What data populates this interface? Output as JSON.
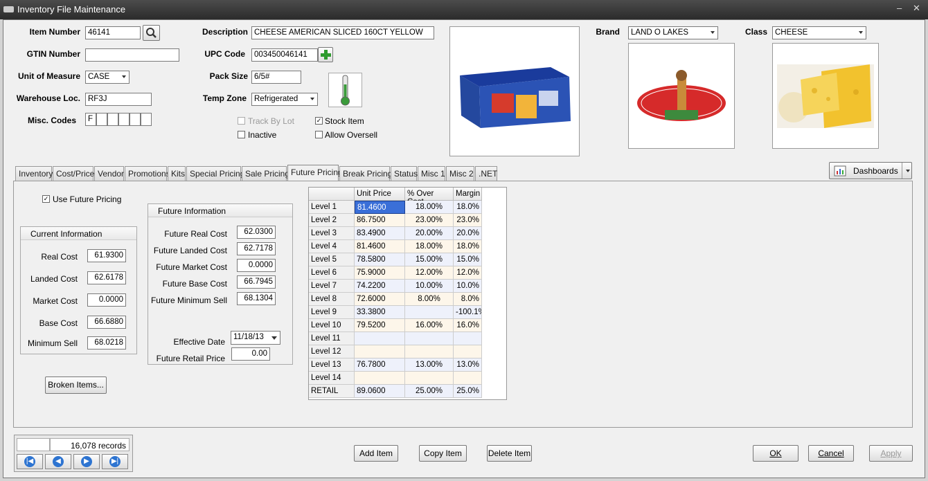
{
  "window": {
    "title": "Inventory File Maintenance",
    "minimize": "–",
    "close": "✕"
  },
  "header": {
    "item_number": {
      "label": "Item Number",
      "value": "46141"
    },
    "gtin": {
      "label": "GTIN Number",
      "value": ""
    },
    "uom": {
      "label": "Unit of Measure",
      "value": "CASE"
    },
    "warehouse": {
      "label": "Warehouse Loc.",
      "value": "RF3J"
    },
    "misc": {
      "label": "Misc. Codes",
      "values": [
        "F",
        "",
        "",
        "",
        "",
        ""
      ]
    },
    "description": {
      "label": "Description",
      "value": "CHEESE AMERICAN SLICED 160CT YELLOW"
    },
    "upc": {
      "label": "UPC Code",
      "value": "003450046141"
    },
    "pack": {
      "label": "Pack Size",
      "value": "6/5#"
    },
    "temp": {
      "label": "Temp Zone",
      "value": "Refrigerated"
    },
    "track_by_lot": {
      "label": "Track By Lot",
      "checked": false
    },
    "inactive": {
      "label": "Inactive",
      "checked": false
    },
    "stock_item": {
      "label": "Stock Item",
      "checked": true
    },
    "allow_oversell": {
      "label": "Allow Oversell",
      "checked": false
    },
    "brand": {
      "label": "Brand",
      "value": "LAND O LAKES"
    },
    "class": {
      "label": "Class",
      "value": "CHEESE"
    }
  },
  "tabs": [
    "Inventory",
    "Cost/Price",
    "Vendor",
    "Promotions",
    "Kits",
    "Special Pricing",
    "Sale Pricing",
    "Future Pricing",
    "Break Pricing",
    "Status",
    "Misc 1",
    "Misc 2",
    ".NET"
  ],
  "active_tab": "Future Pricing",
  "dashboards": "Dashboards",
  "future": {
    "use_future_pricing": "Use Future Pricing",
    "current_title": "Current Information",
    "current": [
      {
        "label": "Real Cost",
        "value": "61.9300"
      },
      {
        "label": "Landed Cost",
        "value": "62.6178"
      },
      {
        "label": "Market Cost",
        "value": "0.0000"
      },
      {
        "label": "Base Cost",
        "value": "66.6880"
      },
      {
        "label": "Minimum Sell",
        "value": "68.0218"
      }
    ],
    "future_title": "Future Information",
    "future_rows": [
      {
        "label": "Future Real Cost",
        "value": "62.0300"
      },
      {
        "label": "Future Landed Cost",
        "value": "62.7178"
      },
      {
        "label": "Future Market Cost",
        "value": "0.0000"
      },
      {
        "label": "Future Base Cost",
        "value": "66.7945"
      },
      {
        "label": "Future Minimum Sell",
        "value": "68.1304"
      }
    ],
    "effective_date": {
      "label": "Effective Date",
      "value": "11/18/13"
    },
    "retail_price": {
      "label": "Future Retail Price",
      "value": "0.00"
    },
    "broken_items": "Broken Items..."
  },
  "grid": {
    "headers": [
      "Unit Price",
      "% Over Cost",
      "Margin"
    ],
    "rows": [
      {
        "level": "Level 1",
        "price": "81.4600",
        "over": "18.00%",
        "margin": "18.0%"
      },
      {
        "level": "Level 2",
        "price": "86.7500",
        "over": "23.00%",
        "margin": "23.0%"
      },
      {
        "level": "Level 3",
        "price": "83.4900",
        "over": "20.00%",
        "margin": "20.0%"
      },
      {
        "level": "Level 4",
        "price": "81.4600",
        "over": "18.00%",
        "margin": "18.0%"
      },
      {
        "level": "Level 5",
        "price": "78.5800",
        "over": "15.00%",
        "margin": "15.0%"
      },
      {
        "level": "Level 6",
        "price": "75.9000",
        "over": "12.00%",
        "margin": "12.0%"
      },
      {
        "level": "Level 7",
        "price": "74.2200",
        "over": "10.00%",
        "margin": "10.0%"
      },
      {
        "level": "Level 8",
        "price": "72.6000",
        "over": "8.00%",
        "margin": "8.0%"
      },
      {
        "level": "Level 9",
        "price": "33.3800",
        "over": "",
        "margin": "-100.1%"
      },
      {
        "level": "Level 10",
        "price": "79.5200",
        "over": "16.00%",
        "margin": "16.0%"
      },
      {
        "level": "Level 11",
        "price": "",
        "over": "",
        "margin": ""
      },
      {
        "level": "Level 12",
        "price": "",
        "over": "",
        "margin": ""
      },
      {
        "level": "Level 13",
        "price": "76.7800",
        "over": "13.00%",
        "margin": "13.0%"
      },
      {
        "level": "Level 14",
        "price": "",
        "over": "",
        "margin": ""
      },
      {
        "level": "RETAIL",
        "price": "89.0600",
        "over": "25.00%",
        "margin": "25.0%"
      }
    ]
  },
  "footer": {
    "records": "16,078 records",
    "add": "Add Item",
    "copy": "Copy Item",
    "delete": "Delete Item",
    "ok": "OK",
    "cancel": "Cancel",
    "apply": "Apply"
  },
  "brand_logo_text": "LAND O LAKES"
}
